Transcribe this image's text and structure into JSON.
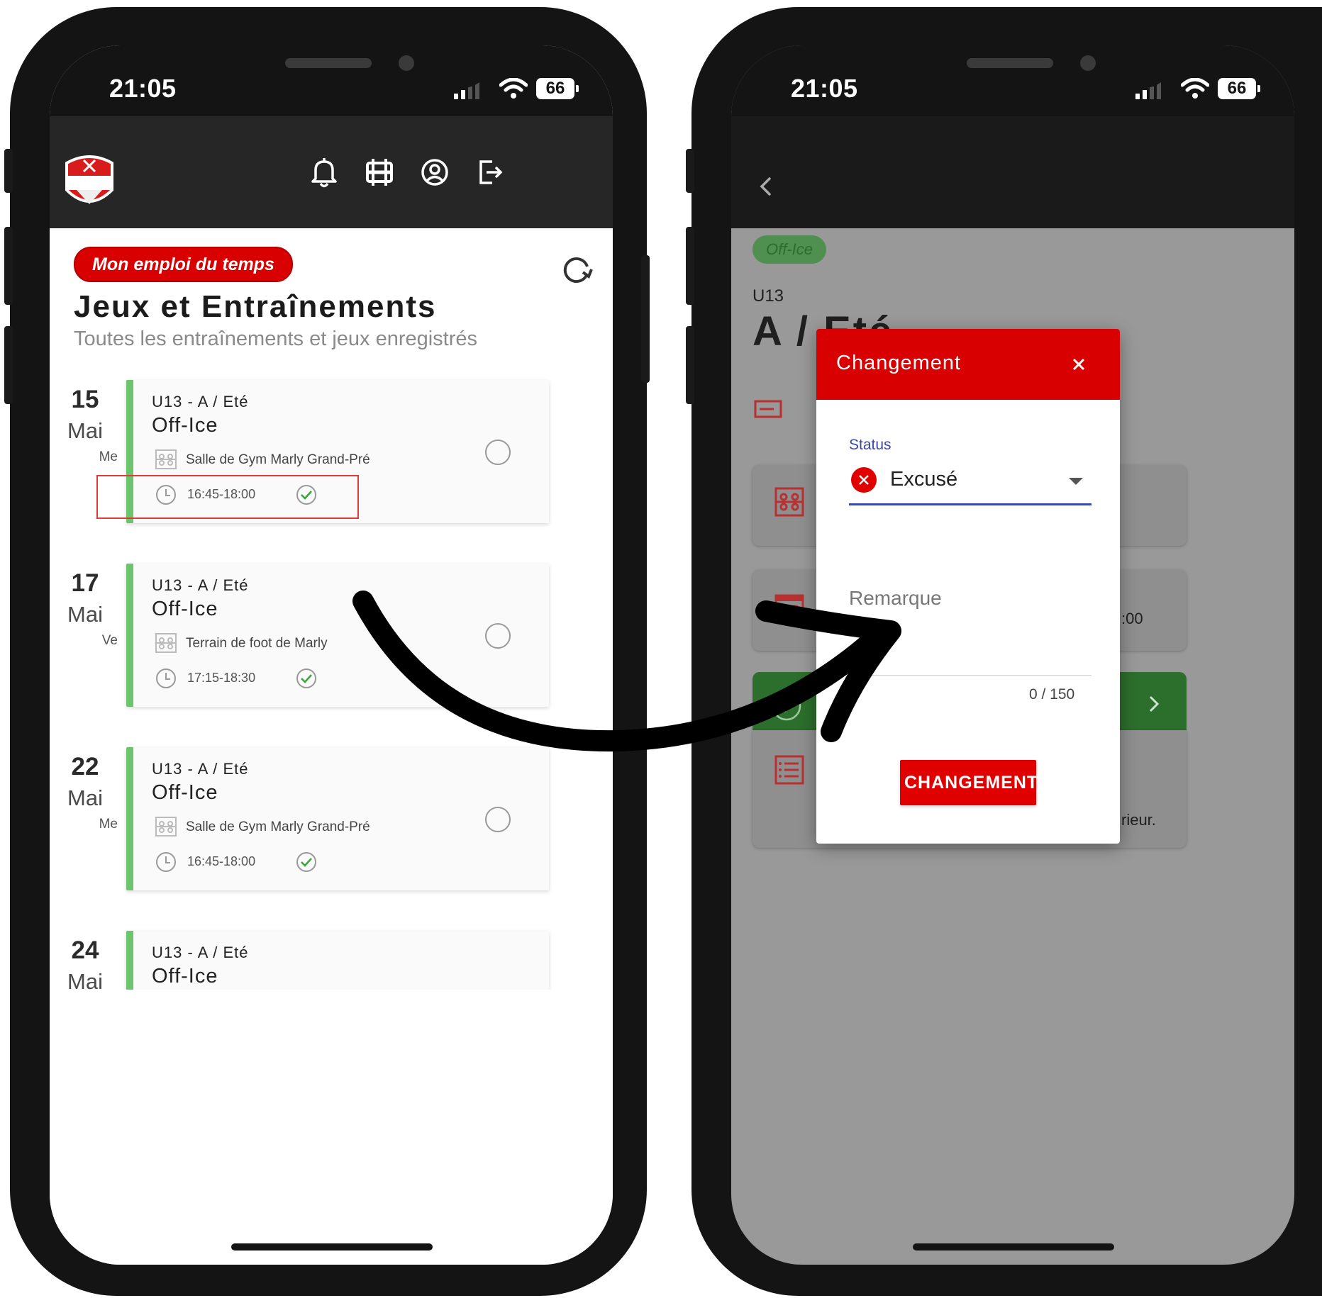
{
  "status_bar": {
    "time": "21:05",
    "battery": "66"
  },
  "left_screen": {
    "pill_label": "Mon emploi du temps",
    "title": "Jeux et Entraînements",
    "subtitle": "Toutes les entraînements et jeux enregistrés",
    "entries": [
      {
        "day": "15",
        "month": "Mai",
        "weekday": "Me",
        "team": "U13 - A / Eté",
        "type": "Off-Ice",
        "location": "Salle de Gym Marly Grand-Pré",
        "time": "16:45-18:00"
      },
      {
        "day": "17",
        "month": "Mai",
        "weekday": "Ve",
        "team": "U13 - A / Eté",
        "type": "Off-Ice",
        "location": "Terrain de foot de Marly",
        "time": "17:15-18:30"
      },
      {
        "day": "22",
        "month": "Mai",
        "weekday": "Me",
        "team": "U13 - A / Eté",
        "type": "Off-Ice",
        "location": "Salle de Gym Marly Grand-Pré",
        "time": "16:45-18:00"
      },
      {
        "day": "24",
        "month": "Mai",
        "weekday": "",
        "team": "U13 - A / Eté",
        "type": "Off-Ice",
        "location": "",
        "time": ""
      }
    ]
  },
  "right_screen": {
    "background": {
      "tag": "Off-Ice",
      "team": "U13",
      "heading": "A / Eté",
      "time_fragment": ":00",
      "text_fragment": "rieur."
    },
    "dialog": {
      "title": "Changement",
      "status_label": "Status",
      "status_value": "Excusé",
      "remark_placeholder": "Remarque",
      "char_count": "0 / 150",
      "submit_label": "CHANGEMENT"
    }
  },
  "colors": {
    "brand_red": "#d80000",
    "accent_green": "#6cc56c",
    "input_blue": "#3949ab"
  },
  "icons": [
    "bell-icon",
    "rink-icon",
    "account-icon",
    "logout-icon",
    "refresh-icon",
    "location-icon",
    "clock-icon",
    "check-icon",
    "back-icon",
    "close-icon"
  ]
}
